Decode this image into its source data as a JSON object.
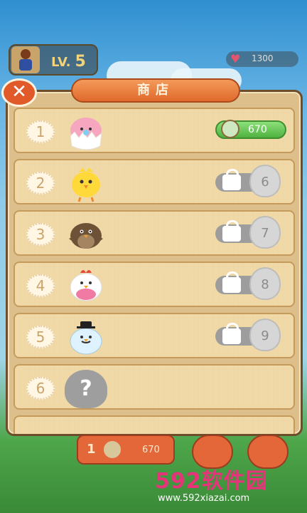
{
  "hud": {
    "level_label": "LV.",
    "level_value": "5",
    "hearts_value": "1300"
  },
  "shop": {
    "title": "商店",
    "close_icon": "x",
    "items": [
      {
        "num": "1",
        "bird": "pink-egg-chick-icon",
        "price": "670",
        "locked": false
      },
      {
        "num": "2",
        "bird": "yellow-chick-icon",
        "unlock_level": "6",
        "locked": true
      },
      {
        "num": "3",
        "bird": "brown-sparrow-icon",
        "unlock_level": "7",
        "locked": true
      },
      {
        "num": "4",
        "bird": "white-hen-icon",
        "unlock_level": "8",
        "locked": true
      },
      {
        "num": "5",
        "bird": "blue-bird-hat-icon",
        "unlock_level": "9",
        "locked": true
      },
      {
        "num": "6",
        "bird": "mystery-bird-icon",
        "mystery": "?",
        "locked": true
      }
    ]
  },
  "bottom": {
    "seed_count": "1",
    "seed_value": "670"
  },
  "watermark": {
    "logo_num": "592",
    "logo_text": "软件园",
    "url": "www.592xiazai.com"
  },
  "colors": {
    "accent": "#e06a2c",
    "panel": "#ddbf8c",
    "price_green": "#4fb23f"
  }
}
